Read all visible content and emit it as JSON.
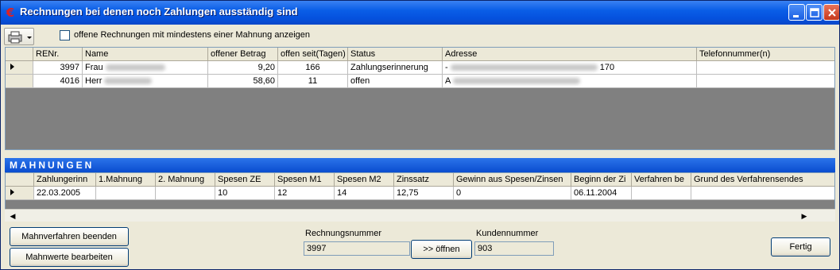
{
  "window": {
    "title": "Rechnungen bei denen noch Zahlungen ausständig sind",
    "icon": "euro-icon"
  },
  "toolbar": {
    "checkbox_label": "offene Rechnungen mit mindestens einer Mahnung anzeigen",
    "checkbox_checked": false
  },
  "invoices": {
    "columns": [
      "RENr.",
      "Name",
      "offener Betrag",
      "offen seit(Tagen)",
      "Status",
      "Adresse",
      "Telefonnummer(n)"
    ],
    "rows": [
      {
        "renr": "3997",
        "name": "Frau",
        "betrag": "9,20",
        "tage": "166",
        "status": "Zahlungserinnerung",
        "adresse_prefix": "-",
        "adresse_suffix": "170",
        "telefon": ""
      },
      {
        "renr": "4016",
        "name": "Herr",
        "betrag": "58,60",
        "tage": "11",
        "status": "offen",
        "adresse_prefix": "A",
        "adresse_suffix": "",
        "telefon": ""
      }
    ]
  },
  "mahnungen": {
    "title": "MAHNUNGEN",
    "columns": [
      "Zahlungerinn",
      "1.Mahnung",
      "2. Mahnung",
      "Spesen ZE",
      "Spesen M1",
      "Spesen M2",
      "Zinssatz",
      "Gewinn aus Spesen/Zinsen",
      "Beginn der Zi",
      "Verfahren be",
      "Grund des Verfahrensendes"
    ],
    "rows": [
      [
        "22.03.2005",
        "",
        "",
        "10",
        "12",
        "14",
        "12,75",
        "0",
        "06.11.2004",
        "",
        ""
      ]
    ]
  },
  "buttons": {
    "end_procedure": "Mahnverfahren beenden",
    "edit_values": "Mahnwerte bearbeiten",
    "open": ">> öffnen",
    "done": "Fertig"
  },
  "footer": {
    "invoice_number_label": "Rechnungsnummer",
    "invoice_number": "3997",
    "customer_number_label": "Kundennummer",
    "customer_number": "903"
  }
}
